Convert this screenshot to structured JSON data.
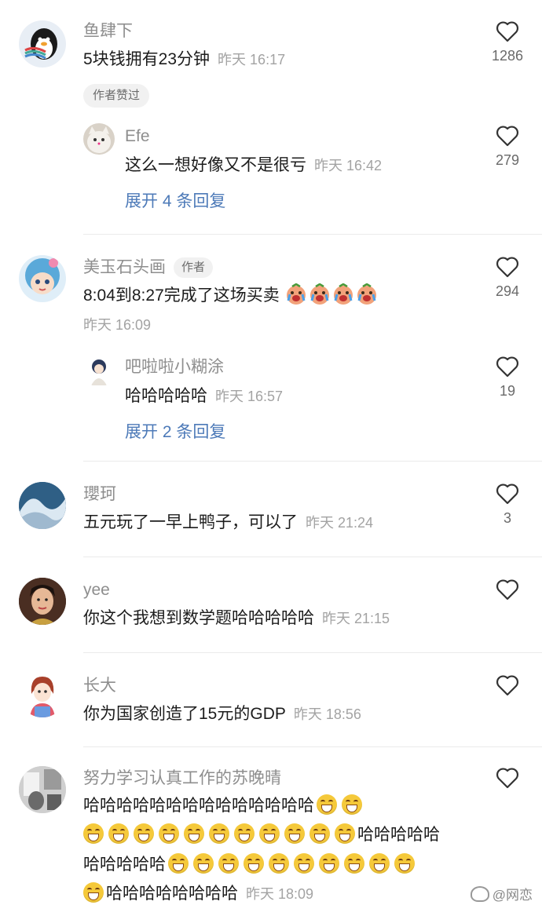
{
  "comments": [
    {
      "username": "鱼肆下",
      "text": "5块钱拥有23分钟",
      "time": "昨天 16:17",
      "likes": "1286",
      "badge": "作者赞过",
      "reply": {
        "username": "Efe",
        "text": "这么一想好像又不是很亏",
        "time": "昨天 16:42",
        "likes": "279"
      },
      "expand": "展开 4 条回复"
    },
    {
      "username": "美玉石头画",
      "author_tag": "作者",
      "text": "8:04到8:27完成了这场买卖",
      "time": "昨天 16:09",
      "likes": "294",
      "reply": {
        "username": "吧啦啦小糊涂",
        "text": "哈哈哈哈哈",
        "time": "昨天 16:57",
        "likes": "19"
      },
      "expand": "展开 2 条回复"
    },
    {
      "username": "瓔珂",
      "text": "五元玩了一早上鸭子，可以了",
      "time": "昨天 21:24",
      "likes": "3"
    },
    {
      "username": "yee",
      "text": "你这个我想到数学题哈哈哈哈哈",
      "time": "昨天 21:15",
      "likes": ""
    },
    {
      "username": "长大",
      "text": "你为国家创造了15元的GDP",
      "time": "昨天 18:56",
      "likes": ""
    },
    {
      "username": "努力学习认真工作的苏晚晴",
      "text_line1": "哈哈哈哈哈哈哈哈哈哈哈哈哈哈",
      "text_line2": "哈哈哈哈哈",
      "text_line3": "哈哈哈哈哈",
      "text_line4": "哈哈哈哈哈哈哈哈",
      "time": "昨天 18:09",
      "likes": ""
    }
  ],
  "watermark": "@网恋",
  "colors": {
    "link": "#4d7ab8",
    "emoji": "#f5c93a"
  },
  "icons": {
    "like": "heart-outline-icon",
    "emoji": "grinning-face-icon",
    "cry": "crying-face-icon"
  }
}
